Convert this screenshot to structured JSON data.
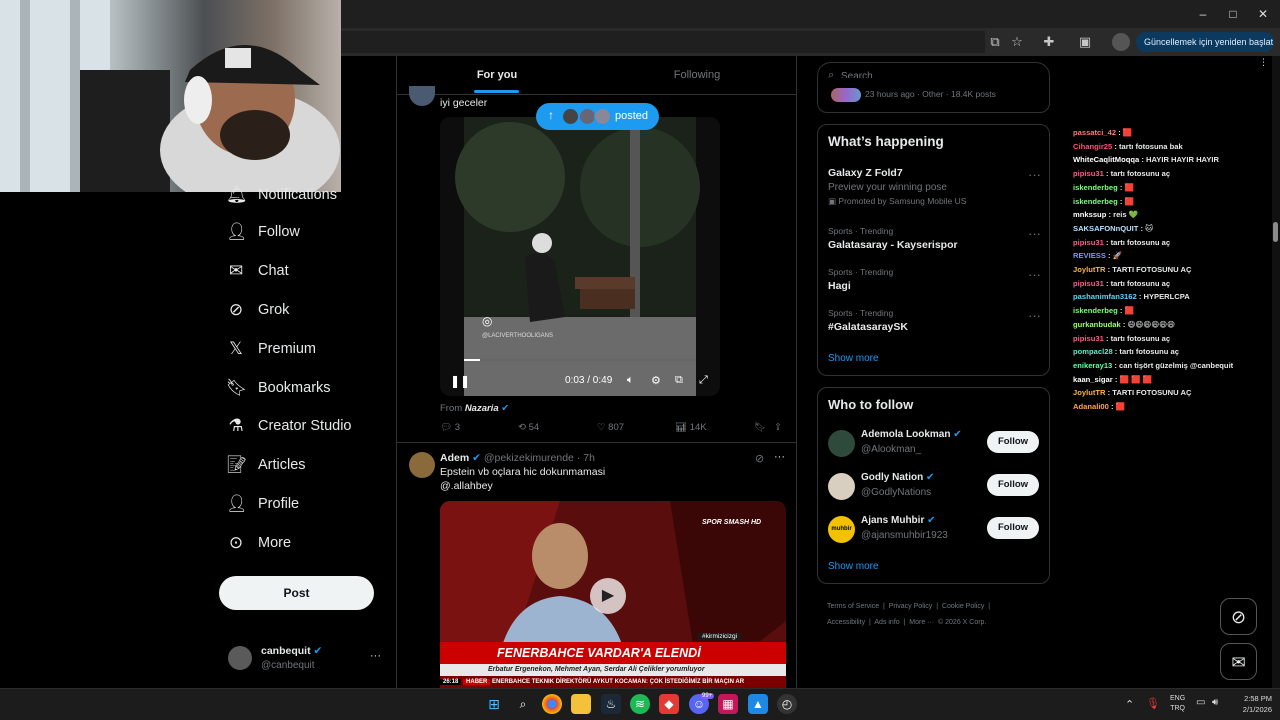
{
  "browser": {
    "window_controls": {
      "minimize": "–",
      "maximize": "□",
      "close": "✕"
    },
    "update_button": "Güncellemek için yeniden başlat"
  },
  "left_nav": {
    "items": [
      {
        "label": "Notifications",
        "icon": "bell-icon"
      },
      {
        "label": "Follow",
        "icon": "person-add-icon"
      },
      {
        "label": "Chat",
        "icon": "mail-icon"
      },
      {
        "label": "Grok",
        "icon": "grok-icon"
      },
      {
        "label": "Premium",
        "icon": "x-logo-icon"
      },
      {
        "label": "Bookmarks",
        "icon": "bookmark-icon"
      },
      {
        "label": "Creator Studio",
        "icon": "flask-icon"
      },
      {
        "label": "Articles",
        "icon": "article-icon"
      },
      {
        "label": "Profile",
        "icon": "person-icon"
      },
      {
        "label": "More",
        "icon": "more-circle-icon"
      }
    ],
    "post_button": "Post",
    "account": {
      "name": "canbequit",
      "handle": "@canbequit",
      "more": "···"
    }
  },
  "feed": {
    "tabs": [
      {
        "label": "For you",
        "active": true
      },
      {
        "label": "Following",
        "active": false
      }
    ],
    "new_posts_pill": "posted",
    "post1": {
      "text": "iyi geceler",
      "video_time": "0:03 / 0:49",
      "watermark": "@LACIVERTHOOLIGANS",
      "from_label": "From",
      "from_name": "Nazaria",
      "stats": {
        "replies": "3",
        "reposts": "54",
        "likes": "807",
        "views": "14K"
      }
    },
    "post2": {
      "name": "Adem",
      "handle": "@pekizekimurende",
      "time": "· 7h",
      "line1": "Epstein vb oçlara hic dokunmamasi",
      "line2": "@.allahbey",
      "tv_logo": "SPOR SMASH HD",
      "tv_hashtag": "#kirmizicizgi",
      "tv_headline": "FENERBAHCE VARDAR'A ELENDİ",
      "tv_names": "Erbatur Ergenekon, Mehmet Ayan, Serdar Ali Çelikler yorumluyor",
      "tv_ticker_time": "26:18",
      "tv_ticker_tag": "HABER",
      "tv_ticker": "ENERBAHCE TEKNIK DİREKTÖRÜ AYKUT KOCAMAN: ÇOK İSTEDİĞİMİZ BİR MAÇIN AR"
    }
  },
  "right": {
    "search_placeholder": "Search",
    "top_card_meta": "23 hours ago · Other · 18.4K posts",
    "whats_happening": {
      "title": "What’s happening",
      "items": [
        {
          "line1": "Galaxy Z Fold7",
          "line2": "Preview your winning pose",
          "line3": "Promoted by Samsung Mobile US"
        },
        {
          "line1": "Sports · Trending",
          "line2": "Galatasaray - Kayserispor"
        },
        {
          "line1": "Sports · Trending",
          "line2": "Hagi"
        },
        {
          "line1": "Sports · Trending",
          "line2": "#GalatasaraySK"
        }
      ],
      "show_more": "Show more"
    },
    "who_to_follow": {
      "title": "Who to follow",
      "accounts": [
        {
          "name": "Ademola Lookman",
          "handle": "@Alookman_",
          "button": "Follow"
        },
        {
          "name": "Godly Nation",
          "handle": "@GodlyNations",
          "button": "Follow"
        },
        {
          "name": "Ajans Muhbir",
          "handle": "@ajansmuhbir1923",
          "button": "Follow",
          "avatar_text": "muhbir"
        }
      ],
      "show_more": "Show more"
    },
    "footer": {
      "links": [
        "Terms of Service",
        "|",
        "Privacy Policy",
        "|",
        "Cookie Policy",
        "|"
      ],
      "links2": [
        "Accessibility",
        "|",
        "Ads info",
        "|",
        "More ···",
        "© 2026 X Corp."
      ]
    }
  },
  "chat": {
    "lines": [
      {
        "user": "passatci_42",
        "color": "#ff7a7a",
        "msg": ": 🟥"
      },
      {
        "user": "Cihangir25",
        "color": "#ff4f7a",
        "msg": ": tartı fotosuna bak"
      },
      {
        "user": "WhiteCaqlitMoqqa",
        "color": "#ffffff",
        "msg": ": HAYIR HAYIR HAYIR"
      },
      {
        "user": "pipisu31",
        "color": "#ff5c8a",
        "msg": ": tartı fotosunu aç"
      },
      {
        "user": "iskenderbeg",
        "color": "#7cff7c",
        "msg": ": 🟥"
      },
      {
        "user": "iskenderbeg",
        "color": "#7cff7c",
        "msg": ": 🟥"
      },
      {
        "user": "mnkssup",
        "color": "#ffffff",
        "msg": ": reis 💚"
      },
      {
        "user": "SAKSAFONnQUIT",
        "color": "#b7e0ff",
        "msg": ": 🐱"
      },
      {
        "user": "pipisu31",
        "color": "#ff5c8a",
        "msg": ": tartı fotosunu aç"
      },
      {
        "user": "REVIESS",
        "color": "#6f9bff",
        "msg": ": 🚀"
      },
      {
        "user": "JoylutTR",
        "color": "#ffb347",
        "msg": ": TARTI FOTOSUNU AÇ"
      },
      {
        "user": "pipisu31",
        "color": "#ff5c8a",
        "msg": ": tartı fotosunu aç"
      },
      {
        "user": "pashanimfan3162",
        "color": "#5fd3ff",
        "msg": ": HYPERLCPA"
      },
      {
        "user": "iskenderbeg",
        "color": "#7cff7c",
        "msg": ": 🟥"
      },
      {
        "user": "gurkanbudak",
        "color": "#9cff6b",
        "msg": ": 😄😄😄😄😄😄"
      },
      {
        "user": "pipisu31",
        "color": "#ff5c8a",
        "msg": ": tartı fotosunu aç"
      },
      {
        "user": "pompacl28",
        "color": "#66e6c9",
        "msg": ": tartı fotosunu aç"
      },
      {
        "user": "enikeray13",
        "color": "#66ffa3",
        "msg": ": can tişört güzelmiş @canbequit"
      },
      {
        "user": "kaan_sigar",
        "color": "#ffffff",
        "msg": ": 🟥 🟥 🟥"
      },
      {
        "user": "JoylutTR",
        "color": "#ffb347",
        "msg": ": TARTI FOTOSUNU AÇ"
      },
      {
        "user": "Adanali00",
        "color": "#ffa64d",
        "msg": ": 🟥"
      }
    ]
  },
  "floating_buttons": {
    "grok": "grok-icon",
    "messages": "mail-icon"
  },
  "system_tray": {
    "lang1": "ENG",
    "lang2": "TRQ",
    "time": "2:58 PM",
    "date": "2/1/2026",
    "badge": "99+"
  }
}
